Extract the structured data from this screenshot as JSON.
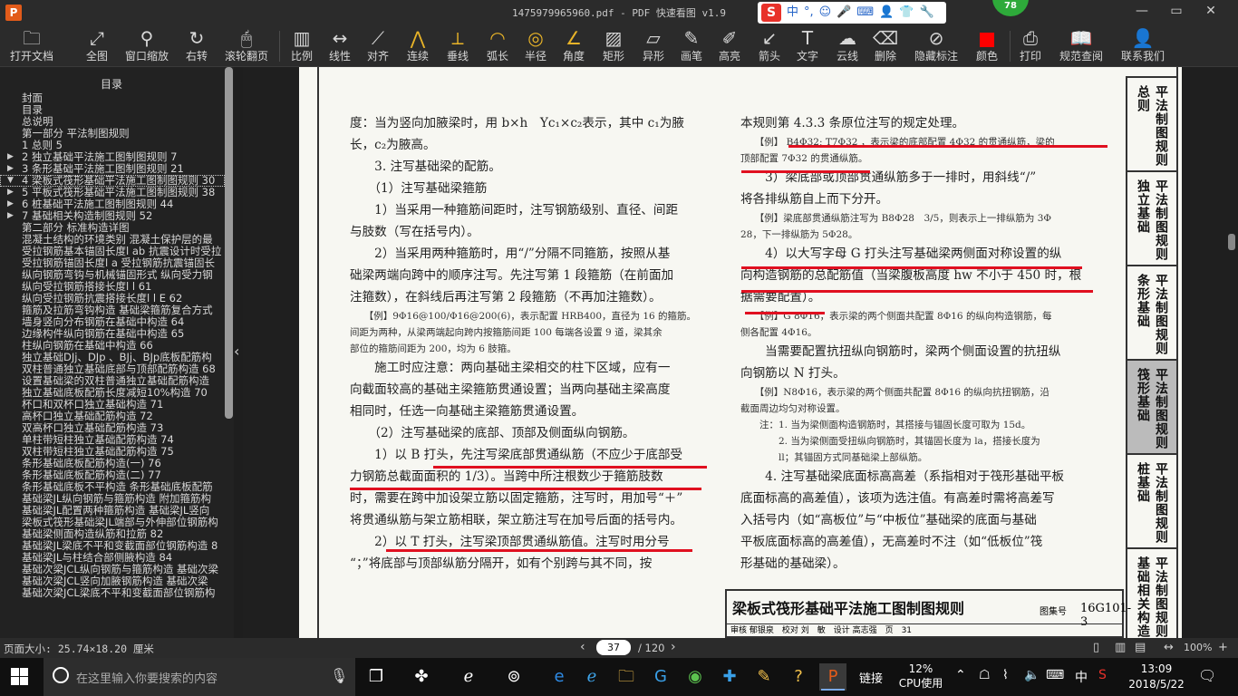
{
  "window": {
    "title": "1475979965960.pdf - PDF 快速看图 v1.9",
    "app_icon": "P",
    "badge": "78",
    "controls": [
      "—",
      "▭",
      "✕"
    ]
  },
  "ime": {
    "logo": "S",
    "items": [
      "中",
      "°,",
      "☺",
      "🎤",
      "⌨",
      "👤",
      "👕",
      "🔧"
    ]
  },
  "toolbar": [
    {
      "label": "打开文档",
      "icon": "folder-icon"
    },
    {
      "label": "全图",
      "icon": "fit-icon"
    },
    {
      "label": "窗口缩放",
      "icon": "zoom-icon"
    },
    {
      "label": "右转",
      "icon": "rotate-icon"
    },
    {
      "label": "滚轮翻页",
      "icon": "mouse-icon"
    },
    {
      "label": "比例",
      "icon": "scale-icon"
    },
    {
      "label": "线性",
      "icon": "linear-icon"
    },
    {
      "label": "对齐",
      "icon": "align-icon"
    },
    {
      "label": "连续",
      "icon": "continuous-icon"
    },
    {
      "label": "垂线",
      "icon": "perpendicular-icon"
    },
    {
      "label": "弧长",
      "icon": "arc-icon"
    },
    {
      "label": "半径",
      "icon": "radius-icon"
    },
    {
      "label": "角度",
      "icon": "angle-icon"
    },
    {
      "label": "矩形",
      "icon": "rect-icon"
    },
    {
      "label": "异形",
      "icon": "polygon-icon"
    },
    {
      "label": "画笔",
      "icon": "pen-icon"
    },
    {
      "label": "高亮",
      "icon": "highlight-icon"
    },
    {
      "label": "箭头",
      "icon": "arrow-icon"
    },
    {
      "label": "文字",
      "icon": "text-icon"
    },
    {
      "label": "云线",
      "icon": "cloud-icon"
    },
    {
      "label": "删除",
      "icon": "eraser-icon"
    },
    {
      "label": "隐藏标注",
      "icon": "eye-off-icon"
    },
    {
      "label": "颜色",
      "icon": "color-icon"
    },
    {
      "label": "打印",
      "icon": "print-icon"
    },
    {
      "label": "规范查阅",
      "icon": "book-icon"
    },
    {
      "label": "联系我们",
      "icon": "contact-icon"
    }
  ],
  "sidebar": {
    "title": "目录",
    "items": [
      {
        "t": "封面"
      },
      {
        "t": "目录"
      },
      {
        "t": "总说明"
      },
      {
        "t": "第一部分 平法制图规则"
      },
      {
        "t": "1 总则 5"
      },
      {
        "t": "2 独立基础平法施工图制图规则 7",
        "arrow": "▶"
      },
      {
        "t": "3 条形基础平法施工图制图规则 21",
        "arrow": "▶"
      },
      {
        "t": "4 梁板式筏形基础平法施工图制图规则 30",
        "arrow": "▼",
        "sel": true
      },
      {
        "t": "5 平板式筏形基础平法施工图制图规则 38",
        "arrow": "▶"
      },
      {
        "t": "6 桩基础平法施工图制图规则 44",
        "arrow": "▶"
      },
      {
        "t": "7 基础相关构造制图规则 52",
        "arrow": "▶"
      },
      {
        "t": "第二部分 标准构造详图"
      },
      {
        "t": "混凝土结构的环境类别 混凝土保护层的最"
      },
      {
        "t": "受拉钢筋基本锚固长度l ab 抗震设计时受拉"
      },
      {
        "t": "受拉钢筋锚固长度l a 受拉钢筋抗震锚固长"
      },
      {
        "t": "纵向钢筋弯钩与机械锚固形式 纵向受力钢"
      },
      {
        "t": "纵向受拉钢筋搭接长度l l 61"
      },
      {
        "t": "纵向受拉钢筋抗震搭接长度l l E 62"
      },
      {
        "t": "箍筋及拉筋弯钩构造 基础梁箍筋复合方式"
      },
      {
        "t": "墙身竖向分布钢筋在基础中构造 64"
      },
      {
        "t": "边缘构件纵向钢筋在基础中构造 65"
      },
      {
        "t": "柱纵向钢筋在基础中构造 66"
      },
      {
        "t": "独立基础DJj、DJp 、BJj、BJp底板配筋构"
      },
      {
        "t": "双柱普通独立基础底部与顶部配筋构造 68"
      },
      {
        "t": "设置基础梁的双柱普通独立基础配筋构造"
      },
      {
        "t": "独立基础底板配筋长度减短10%构造 70"
      },
      {
        "t": "杯口和双杯口独立基础构造 71"
      },
      {
        "t": "高杯口独立基础配筋构造 72"
      },
      {
        "t": "双高杯口独立基础配筋构造 73"
      },
      {
        "t": "单柱带短柱独立基础配筋构造 74"
      },
      {
        "t": "双柱带短柱独立基础配筋构造 75"
      },
      {
        "t": "条形基础底板配筋构造(一) 76"
      },
      {
        "t": "条形基础底板配筋构造(二) 77"
      },
      {
        "t": "条形基础底板不平构造 条形基础底板配筋"
      },
      {
        "t": "基础梁JL纵向钢筋与箍筋构造 附加箍筋构"
      },
      {
        "t": "基础梁JL配置两种箍筋构造 基础梁JL竖向"
      },
      {
        "t": "梁板式筏形基础梁JL端部与外伸部位钢筋构"
      },
      {
        "t": "基础梁侧面构造纵筋和拉筋 82"
      },
      {
        "t": "基础梁JL梁底不平和变截面部位钢筋构造 8"
      },
      {
        "t": "基础梁JL与柱结合部侧腋构造 84"
      },
      {
        "t": "基础次梁JCL纵向钢筋与箍筋构造 基础次梁"
      },
      {
        "t": "基础次梁JCL竖向加腋钢筋构造 基础次梁"
      },
      {
        "t": "基础次梁JCL梁底不平和变截面部位钢筋构"
      }
    ]
  },
  "doc": {
    "left": [
      {
        "k": "p",
        "t": "度：当为竖向加腋梁时，用 b×h　Yc₁×c₂表示，其中 c₁为腋"
      },
      {
        "k": "p",
        "t": "长，c₂为腋高。"
      },
      {
        "k": "p",
        "t": "　　3. 注写基础梁的配筋。"
      },
      {
        "k": "p",
        "t": "　　（1）注写基础梁箍筋"
      },
      {
        "k": "p",
        "t": "　　1）当采用一种箍筋间距时，注写钢筋级别、直径、间距"
      },
      {
        "k": "p",
        "t": "与肢数（写在括号内）。"
      },
      {
        "k": "p",
        "t": "　　2）当采用两种箍筋时，用“/”分隔不同箍筋，按照从基"
      },
      {
        "k": "p",
        "t": "础梁两端向跨中的顺序注写。先注写第 1 段箍筋（在前面加"
      },
      {
        "k": "p",
        "t": "注箍数），在斜线后再注写第 2 段箍筋（不再加注箍数）。"
      },
      {
        "k": "ex",
        "t": "　　【例】9Φ16@100/Φ16@200(6)，表示配置 HRB400，直径为 16 的箍筋。"
      },
      {
        "k": "ex",
        "t": "间距为两种，从梁两端起向跨内按箍筋间距 100 每端各设置 9 道，梁其余"
      },
      {
        "k": "ex",
        "t": "部位的箍筋间距为 200，均为 6 肢箍。"
      },
      {
        "k": "p",
        "t": "　　施工时应注意：两向基础主梁相交的柱下区域，应有一"
      },
      {
        "k": "p",
        "t": "向截面较高的基础主梁箍筋贯通设置；当两向基础主梁高度"
      },
      {
        "k": "p",
        "t": "相同时，任选一向基础主梁箍筋贯通设置。"
      },
      {
        "k": "p",
        "t": "　　（2）注写基础梁的底部、顶部及侧面纵向钢筋。"
      },
      {
        "k": "p",
        "t": "　　1）以 B 打头，先注写梁底部贯通纵筋（不应少于底部受"
      },
      {
        "k": "p",
        "t": "力钢筋总截面面积的 1/3）。当跨中所注根数少于箍筋肢数"
      },
      {
        "k": "p",
        "t": "时，需要在跨中加设架立筋以固定箍筋，注写时，用加号“＋”"
      },
      {
        "k": "p",
        "t": "将贯通纵筋与架立筋相联，架立筋注写在加号后面的括号内。"
      },
      {
        "k": "p",
        "t": "　　2）以 T 打头，注写梁顶部贯通纵筋值。注写时用分号"
      },
      {
        "k": "p",
        "t": "“；”将底部与顶部纵筋分隔开，如有个别跨与其不同，按"
      }
    ],
    "right": [
      {
        "k": "p",
        "t": "本规则第 4.3.3 条原位注写的规定处理。"
      },
      {
        "k": "ex",
        "t": "　　【例】 B4Φ32; T7Φ32 ，表示梁的底部配置 4Φ32 的贯通纵筋，梁的"
      },
      {
        "k": "ex",
        "t": "顶部配置 7Φ32 的贯通纵筋。"
      },
      {
        "k": "p",
        "t": "　　3）梁底部或顶部贯通纵筋多于一排时，用斜线“/”"
      },
      {
        "k": "p",
        "t": "将各排纵筋自上而下分开。"
      },
      {
        "k": "ex",
        "t": "　　【例】梁底部贯通纵筋注写为 B8Φ28　3/5，则表示上一排纵筋为 3Φ"
      },
      {
        "k": "ex",
        "t": "28，下一排纵筋为 5Φ28。"
      },
      {
        "k": "p",
        "t": "　　4）以大写字母 G 打头注写基础梁两侧面对称设置的纵"
      },
      {
        "k": "p",
        "t": "向构造钢筋的总配筋值（当梁腹板高度 hw 不小于 450 时，根"
      },
      {
        "k": "p",
        "t": "据需要配置）。"
      },
      {
        "k": "ex",
        "t": "　　【例】G 8Φ16，表示梁的两个侧面共配置 8Φ16 的纵向构造钢筋，每"
      },
      {
        "k": "ex",
        "t": "侧各配置 4Φ16。"
      },
      {
        "k": "p",
        "t": "　　当需要配置抗扭纵向钢筋时，梁两个侧面设置的抗扭纵"
      },
      {
        "k": "p",
        "t": "向钢筋以 N 打头。"
      },
      {
        "k": "ex",
        "t": "　　【例】N8Φ16，表示梁的两个侧面共配置 8Φ16 的纵向抗扭钢筋，沿"
      },
      {
        "k": "ex",
        "t": "截面周边均匀对称设置。"
      },
      {
        "k": "ex",
        "t": "　　注：1. 当为梁侧面构造钢筋时，其搭接与锚固长度可取为 15d。"
      },
      {
        "k": "ex",
        "t": "　　　　2. 当为梁侧面受扭纵向钢筋时，其锚固长度为 la，搭接长度为"
      },
      {
        "k": "ex",
        "t": "　　　　ll；其锚固方式同基础梁上部纵筋。"
      },
      {
        "k": "p",
        "t": "　　4. 注写基础梁底面标高高差（系指相对于筏形基础平板"
      },
      {
        "k": "p",
        "t": "底面标高的高差值），该项为选注值。有高差时需将高差写"
      },
      {
        "k": "p",
        "t": "入括号内（如“高板位”与“中板位”基础梁的底面与基础"
      },
      {
        "k": "p",
        "t": "平板底面标高的高差值），无高差时不注（如“低板位”筏"
      },
      {
        "k": "p",
        "t": "形基础的基础梁）。"
      }
    ],
    "tabs": [
      "平法制图规则总则",
      "平法制图规则独立基础",
      "平法制图规则条形基础",
      "平法制图规则筏形基础",
      "平法制图规则桩基础",
      "平法制图规则基础相关构造"
    ],
    "title_block": {
      "title": "梁板式筏形基础平法施工图制图规则",
      "label": "图集号",
      "code": "16G101-3",
      "row": "审核 郁银泉　校对 刘　敏　设计 高志强　页　31"
    }
  },
  "status": {
    "size": "页面大小: 25.74×18.20 厘米",
    "page": "37",
    "total": "/ 120",
    "zoom": "100%"
  },
  "taskbar": {
    "search": "在这里输入你要搜索的内容",
    "link": "链接",
    "cpu": "12%",
    "cpu_label": "CPU使用",
    "lang": "中",
    "time": "13:09",
    "date": "2018/5/22"
  }
}
